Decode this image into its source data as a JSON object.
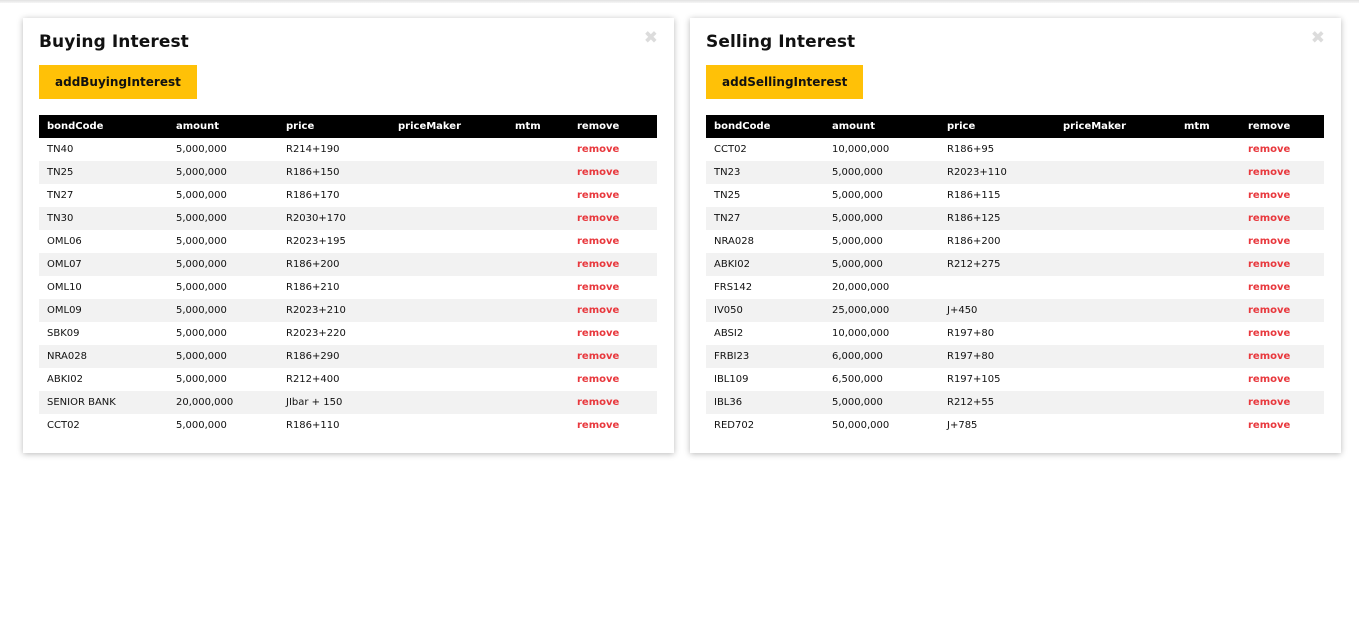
{
  "buying": {
    "title": "Buying Interest",
    "add_label": "addBuyingInterest",
    "close_glyph": "✖",
    "columns": [
      "bondCode",
      "amount",
      "price",
      "priceMaker",
      "mtm",
      "remove"
    ],
    "rows": [
      {
        "bondCode": "TN40",
        "amount": "5,000,000",
        "price": "R214+190",
        "priceMaker": "",
        "mtm": "",
        "remove": "remove"
      },
      {
        "bondCode": "TN25",
        "amount": "5,000,000",
        "price": "R186+150",
        "priceMaker": "",
        "mtm": "",
        "remove": "remove"
      },
      {
        "bondCode": "TN27",
        "amount": "5,000,000",
        "price": "R186+170",
        "priceMaker": "",
        "mtm": "",
        "remove": "remove"
      },
      {
        "bondCode": "TN30",
        "amount": "5,000,000",
        "price": "R2030+170",
        "priceMaker": "",
        "mtm": "",
        "remove": "remove"
      },
      {
        "bondCode": "OML06",
        "amount": "5,000,000",
        "price": "R2023+195",
        "priceMaker": "",
        "mtm": "",
        "remove": "remove"
      },
      {
        "bondCode": "OML07",
        "amount": "5,000,000",
        "price": "R186+200",
        "priceMaker": "",
        "mtm": "",
        "remove": "remove"
      },
      {
        "bondCode": "OML10",
        "amount": "5,000,000",
        "price": "R186+210",
        "priceMaker": "",
        "mtm": "",
        "remove": "remove"
      },
      {
        "bondCode": "OML09",
        "amount": "5,000,000",
        "price": "R2023+210",
        "priceMaker": "",
        "mtm": "",
        "remove": "remove"
      },
      {
        "bondCode": "SBK09",
        "amount": "5,000,000",
        "price": "R2023+220",
        "priceMaker": "",
        "mtm": "",
        "remove": "remove"
      },
      {
        "bondCode": "NRA028",
        "amount": "5,000,000",
        "price": "R186+290",
        "priceMaker": "",
        "mtm": "",
        "remove": "remove"
      },
      {
        "bondCode": "ABKI02",
        "amount": "5,000,000",
        "price": "R212+400",
        "priceMaker": "",
        "mtm": "",
        "remove": "remove"
      },
      {
        "bondCode": "SENIOR BANK",
        "amount": "20,000,000",
        "price": "JIbar + 150",
        "priceMaker": "",
        "mtm": "",
        "remove": "remove"
      },
      {
        "bondCode": "CCT02",
        "amount": "5,000,000",
        "price": "R186+110",
        "priceMaker": "",
        "mtm": "",
        "remove": "remove"
      }
    ]
  },
  "selling": {
    "title": "Selling Interest",
    "add_label": "addSellingInterest",
    "close_glyph": "✖",
    "columns": [
      "bondCode",
      "amount",
      "price",
      "priceMaker",
      "mtm",
      "remove"
    ],
    "rows": [
      {
        "bondCode": "CCT02",
        "amount": "10,000,000",
        "price": "R186+95",
        "priceMaker": "",
        "mtm": "",
        "remove": "remove"
      },
      {
        "bondCode": "TN23",
        "amount": "5,000,000",
        "price": "R2023+110",
        "priceMaker": "",
        "mtm": "",
        "remove": "remove"
      },
      {
        "bondCode": "TN25",
        "amount": "5,000,000",
        "price": "R186+115",
        "priceMaker": "",
        "mtm": "",
        "remove": "remove"
      },
      {
        "bondCode": "TN27",
        "amount": "5,000,000",
        "price": "R186+125",
        "priceMaker": "",
        "mtm": "",
        "remove": "remove"
      },
      {
        "bondCode": "NRA028",
        "amount": "5,000,000",
        "price": "R186+200",
        "priceMaker": "",
        "mtm": "",
        "remove": "remove"
      },
      {
        "bondCode": "ABKI02",
        "amount": "5,000,000",
        "price": "R212+275",
        "priceMaker": "",
        "mtm": "",
        "remove": "remove"
      },
      {
        "bondCode": "FRS142",
        "amount": "20,000,000",
        "price": "",
        "priceMaker": "",
        "mtm": "",
        "remove": "remove"
      },
      {
        "bondCode": "IV050",
        "amount": "25,000,000",
        "price": "J+450",
        "priceMaker": "",
        "mtm": "",
        "remove": "remove"
      },
      {
        "bondCode": "ABSI2",
        "amount": "10,000,000",
        "price": "R197+80",
        "priceMaker": "",
        "mtm": "",
        "remove": "remove"
      },
      {
        "bondCode": "FRBI23",
        "amount": "6,000,000",
        "price": "R197+80",
        "priceMaker": "",
        "mtm": "",
        "remove": "remove"
      },
      {
        "bondCode": "IBL109",
        "amount": "6,500,000",
        "price": "R197+105",
        "priceMaker": "",
        "mtm": "",
        "remove": "remove"
      },
      {
        "bondCode": "IBL36",
        "amount": "5,000,000",
        "price": "R212+55",
        "priceMaker": "",
        "mtm": "",
        "remove": "remove"
      },
      {
        "bondCode": "RED702",
        "amount": "50,000,000",
        "price": "J+785",
        "priceMaker": "",
        "mtm": "",
        "remove": "remove"
      }
    ]
  }
}
